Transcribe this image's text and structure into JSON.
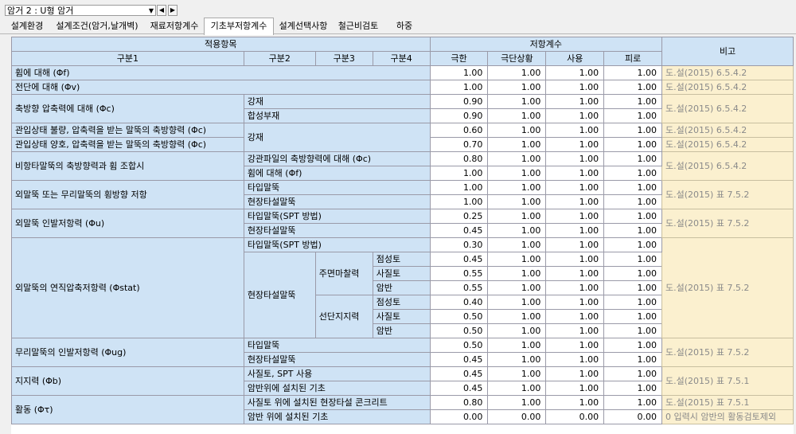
{
  "window": {
    "selector_value": "암거 2 : U형 암거",
    "prev_label": "◀",
    "next_label": "▶"
  },
  "tabs": [
    {
      "label": "설계환경",
      "active": false
    },
    {
      "label": "설계조건(암거,날개벽)",
      "active": false
    },
    {
      "label": "재료저항계수",
      "active": false
    },
    {
      "label": "기초부저항계수",
      "active": true
    },
    {
      "label": "설계선택사항",
      "active": false
    },
    {
      "label": "철근비검토",
      "active": false
    },
    {
      "label": "하중",
      "active": false
    }
  ],
  "table": {
    "group_headers": {
      "applicable": "적용항목",
      "resistance": "저항계수",
      "remark": "비고"
    },
    "sub_headers": {
      "cat1": "구분1",
      "cat2": "구분2",
      "cat3": "구분3",
      "cat4": "구분4",
      "limit": "극한",
      "extreme": "극단상황",
      "service": "사용",
      "fatigue": "피로"
    },
    "rows": [
      {
        "c1": "휨에 대해 (Φf)",
        "c2": "",
        "c3": "",
        "c4": "",
        "v": [
          "1.00",
          "1.00",
          "1.00",
          "1.00"
        ],
        "remark": "도.설(2015) 6.5.4.2"
      },
      {
        "c1": "전단에 대해 (Φv)",
        "c2": "",
        "c3": "",
        "c4": "",
        "v": [
          "1.00",
          "1.00",
          "1.00",
          "1.00"
        ],
        "remark": "도.설(2015) 6.5.4.2"
      },
      {
        "c1": "축방향 압축력에 대해 (Φc)",
        "c2": "강재",
        "c3": "",
        "c4": "",
        "v": [
          "0.90",
          "1.00",
          "1.00",
          "1.00"
        ],
        "remark": "도.설(2015) 6.5.4.2"
      },
      {
        "c1": "",
        "c2": "합성부재",
        "c3": "",
        "c4": "",
        "v": [
          "0.90",
          "1.00",
          "1.00",
          "1.00"
        ],
        "remark": ""
      },
      {
        "c1": "관입상태 불량, 압축력을 받는 말뚝의 축방향력 (Φc)",
        "c2": "강재",
        "c3": "",
        "c4": "",
        "v": [
          "0.60",
          "1.00",
          "1.00",
          "1.00"
        ],
        "remark": "도.설(2015) 6.5.4.2"
      },
      {
        "c1": "관입상태 양호, 압축력을 받는 말뚝의 축방향력 (Φc)",
        "c2": "",
        "c3": "",
        "c4": "",
        "v": [
          "0.70",
          "1.00",
          "1.00",
          "1.00"
        ],
        "remark": "도.설(2015) 6.5.4.2"
      },
      {
        "c1": "비항타말뚝의 축방향력과 휨 조합시",
        "c2": "강관파일의 축방향력에 대해 (Φc)",
        "c3": "",
        "c4": "",
        "v": [
          "0.80",
          "1.00",
          "1.00",
          "1.00"
        ],
        "remark": "도.설(2015) 6.5.4.2"
      },
      {
        "c1": "",
        "c2": "휨에 대해 (Φf)",
        "c3": "",
        "c4": "",
        "v": [
          "1.00",
          "1.00",
          "1.00",
          "1.00"
        ],
        "remark": ""
      },
      {
        "c1": "외말뚝 또는 무리말뚝의 횡방향 저항",
        "c2": "타입말뚝",
        "c3": "",
        "c4": "",
        "v": [
          "1.00",
          "1.00",
          "1.00",
          "1.00"
        ],
        "remark": "도.설(2015) 표 7.5.2"
      },
      {
        "c1": "",
        "c2": "현장타설말뚝",
        "c3": "",
        "c4": "",
        "v": [
          "1.00",
          "1.00",
          "1.00",
          "1.00"
        ],
        "remark": ""
      },
      {
        "c1": "외말뚝 인발저항력 (Φu)",
        "c2": "타입말뚝(SPT 방법)",
        "c3": "",
        "c4": "",
        "v": [
          "0.25",
          "1.00",
          "1.00",
          "1.00"
        ],
        "remark": "도.설(2015) 표 7.5.2"
      },
      {
        "c1": "",
        "c2": "현장타설말뚝",
        "c3": "",
        "c4": "",
        "v": [
          "0.45",
          "1.00",
          "1.00",
          "1.00"
        ],
        "remark": ""
      },
      {
        "c1": "외말뚝의 연직압축저항력 (Φstat)",
        "c2": "타입말뚝(SPT 방법)",
        "c3": "",
        "c4": "",
        "v": [
          "0.30",
          "1.00",
          "1.00",
          "1.00"
        ],
        "remark": "도.설(2015) 표 7.5.2"
      },
      {
        "c1": "",
        "c2": "현장타설말뚝",
        "c3": "주면마찰력",
        "c4": "점성토",
        "v": [
          "0.45",
          "1.00",
          "1.00",
          "1.00"
        ],
        "remark": ""
      },
      {
        "c1": "",
        "c2": "",
        "c3": "",
        "c4": "사질토",
        "v": [
          "0.55",
          "1.00",
          "1.00",
          "1.00"
        ],
        "remark": ""
      },
      {
        "c1": "",
        "c2": "",
        "c3": "",
        "c4": "암반",
        "v": [
          "0.55",
          "1.00",
          "1.00",
          "1.00"
        ],
        "remark": ""
      },
      {
        "c1": "",
        "c2": "",
        "c3": "선단지지력",
        "c4": "점성토",
        "v": [
          "0.40",
          "1.00",
          "1.00",
          "1.00"
        ],
        "remark": ""
      },
      {
        "c1": "",
        "c2": "",
        "c3": "",
        "c4": "사질토",
        "v": [
          "0.50",
          "1.00",
          "1.00",
          "1.00"
        ],
        "remark": ""
      },
      {
        "c1": "",
        "c2": "",
        "c3": "",
        "c4": "암반",
        "v": [
          "0.50",
          "1.00",
          "1.00",
          "1.00"
        ],
        "remark": ""
      },
      {
        "c1": "무리말뚝의 인발저항력 (Φug)",
        "c2": "타입말뚝",
        "c3": "",
        "c4": "",
        "v": [
          "0.50",
          "1.00",
          "1.00",
          "1.00"
        ],
        "remark": "도.설(2015) 표 7.5.2"
      },
      {
        "c1": "",
        "c2": "현장타설말뚝",
        "c3": "",
        "c4": "",
        "v": [
          "0.45",
          "1.00",
          "1.00",
          "1.00"
        ],
        "remark": ""
      },
      {
        "c1": "지지력 (Φb)",
        "c2": "사질토, SPT 사용",
        "c3": "",
        "c4": "",
        "v": [
          "0.45",
          "1.00",
          "1.00",
          "1.00"
        ],
        "remark": "도.설(2015) 표 7.5.1"
      },
      {
        "c1": "",
        "c2": "암반위에 설치된 기초",
        "c3": "",
        "c4": "",
        "v": [
          "0.45",
          "1.00",
          "1.00",
          "1.00"
        ],
        "remark": ""
      },
      {
        "c1": "활동 (Φτ)",
        "c2": "사질토 위에 설치된 현장타설 콘크리트",
        "c3": "",
        "c4": "",
        "v": [
          "0.80",
          "1.00",
          "1.00",
          "1.00"
        ],
        "remark": "도.설(2015) 표 7.5.1"
      },
      {
        "c1": "",
        "c2": "암반 위에 설치된 기초",
        "c3": "",
        "c4": "",
        "v": [
          "0.00",
          "0.00",
          "0.00",
          "0.00"
        ],
        "remark": "0 입력시 암반의 활동검토제외"
      }
    ]
  }
}
